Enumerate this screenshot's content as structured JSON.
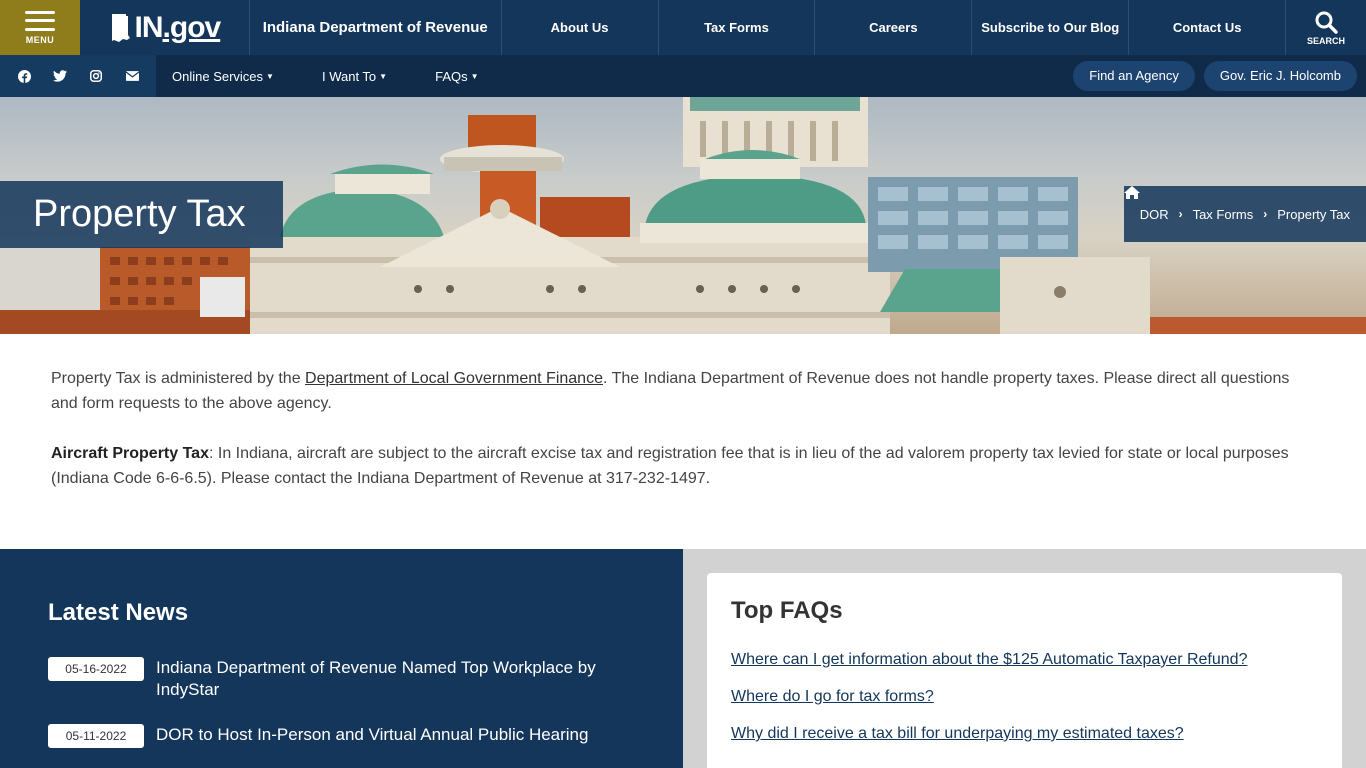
{
  "header": {
    "menu_label": "MENU",
    "logo_text_a": "IN",
    "logo_text_b": ".gov",
    "agency": "Indiana Department of Revenue",
    "nav": [
      "About Us",
      "Tax Forms",
      "Careers",
      "Subscribe to Our Blog",
      "Contact Us"
    ],
    "search_label": "SEARCH"
  },
  "subbar": {
    "socials": [
      "facebook-icon",
      "twitter-icon",
      "instagram-icon",
      "email-icon"
    ],
    "items": [
      "Online Services",
      "I Want To",
      "FAQs"
    ],
    "pills": [
      "Find an Agency",
      "Gov. Eric J. Holcomb"
    ]
  },
  "hero": {
    "title": "Property Tax",
    "breadcrumb": [
      "DOR",
      "Tax Forms",
      "Property Tax"
    ]
  },
  "content": {
    "p1_a": "Property Tax is administered by the ",
    "p1_link": "Department of Local Government Finance",
    "p1_b": ". The Indiana Department of Revenue does not handle property taxes. Please direct all questions and form requests to the above agency.",
    "p2_bold": "Aircraft Property Tax",
    "p2_text": ": In Indiana, aircraft are subject to the aircraft excise tax and registration fee that is in lieu of the ad valorem property tax levied for state or local purposes (Indiana Code 6-6-6.5). Please contact the Indiana Department of Revenue at 317-232-1497."
  },
  "news": {
    "title": "Latest News",
    "items": [
      {
        "date": "05-16-2022",
        "text": "Indiana Department of Revenue Named Top Workplace by IndyStar"
      },
      {
        "date": "05-11-2022",
        "text": "DOR to Host In-Person and Virtual Annual Public Hearing"
      }
    ]
  },
  "faqs": {
    "title": "Top FAQs",
    "items": [
      "Where can I get information about the $125 Automatic Taxpayer Refund?",
      "Where do I go for tax forms?",
      "Why did I receive a tax bill for underpaying my estimated taxes?"
    ]
  },
  "colors": {
    "navy": "#13365a",
    "gold": "#8f7d1c",
    "dome_green": "#4e9c85"
  }
}
